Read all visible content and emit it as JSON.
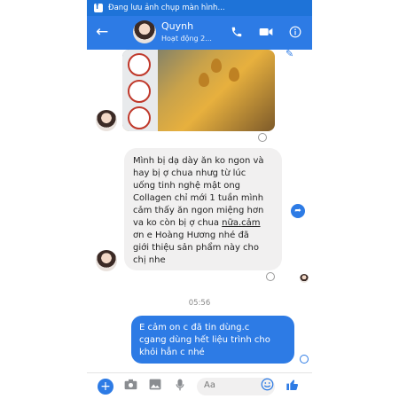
{
  "status_bar": {
    "text": "Đang lưu ảnh chụp màn hình..."
  },
  "header": {
    "back_icon": "arrow-left-icon",
    "contact_name": "Quynh",
    "presence": "Hoạt động 2...",
    "call_icon": "phone-icon",
    "video_icon": "video-icon",
    "info_icon": "info-icon"
  },
  "message_in": {
    "line1": "Mình bị dạ dày ăn ko ngon và",
    "line2": "hay bị ợ chua nhưg từ lúc",
    "line3": "uống tinh nghệ mật ong",
    "line4": "Collagen chỉ mới 1 tuần mình",
    "line5": "cảm thấy ăn ngon miệng hơn",
    "line6a": "va ko còn bị ợ chua ",
    "line6b": "nữa.cảm",
    "line7": "ơn e Hoàng Hương nhé đã",
    "line8": "giới thiệu sản phẩm này cho",
    "line9": "chị nhe"
  },
  "timestamp": "05:56",
  "message_out": {
    "text": "E cảm on c đã tin dùng.c\ncgang dùng hết liệu trình cho\nkhỏi hẳn c nhé"
  },
  "composer": {
    "placeholder": "Aa",
    "plus_icon": "plus-icon",
    "camera_icon": "camera-icon",
    "gallery_icon": "image-icon",
    "mic_icon": "mic-icon",
    "emoji_icon": "smiley-icon",
    "like_icon": "thumbs-up-icon"
  },
  "colors": {
    "brand": "#2d7be5",
    "status": "#1e73d8",
    "bubble_in": "#f1f0f0"
  }
}
